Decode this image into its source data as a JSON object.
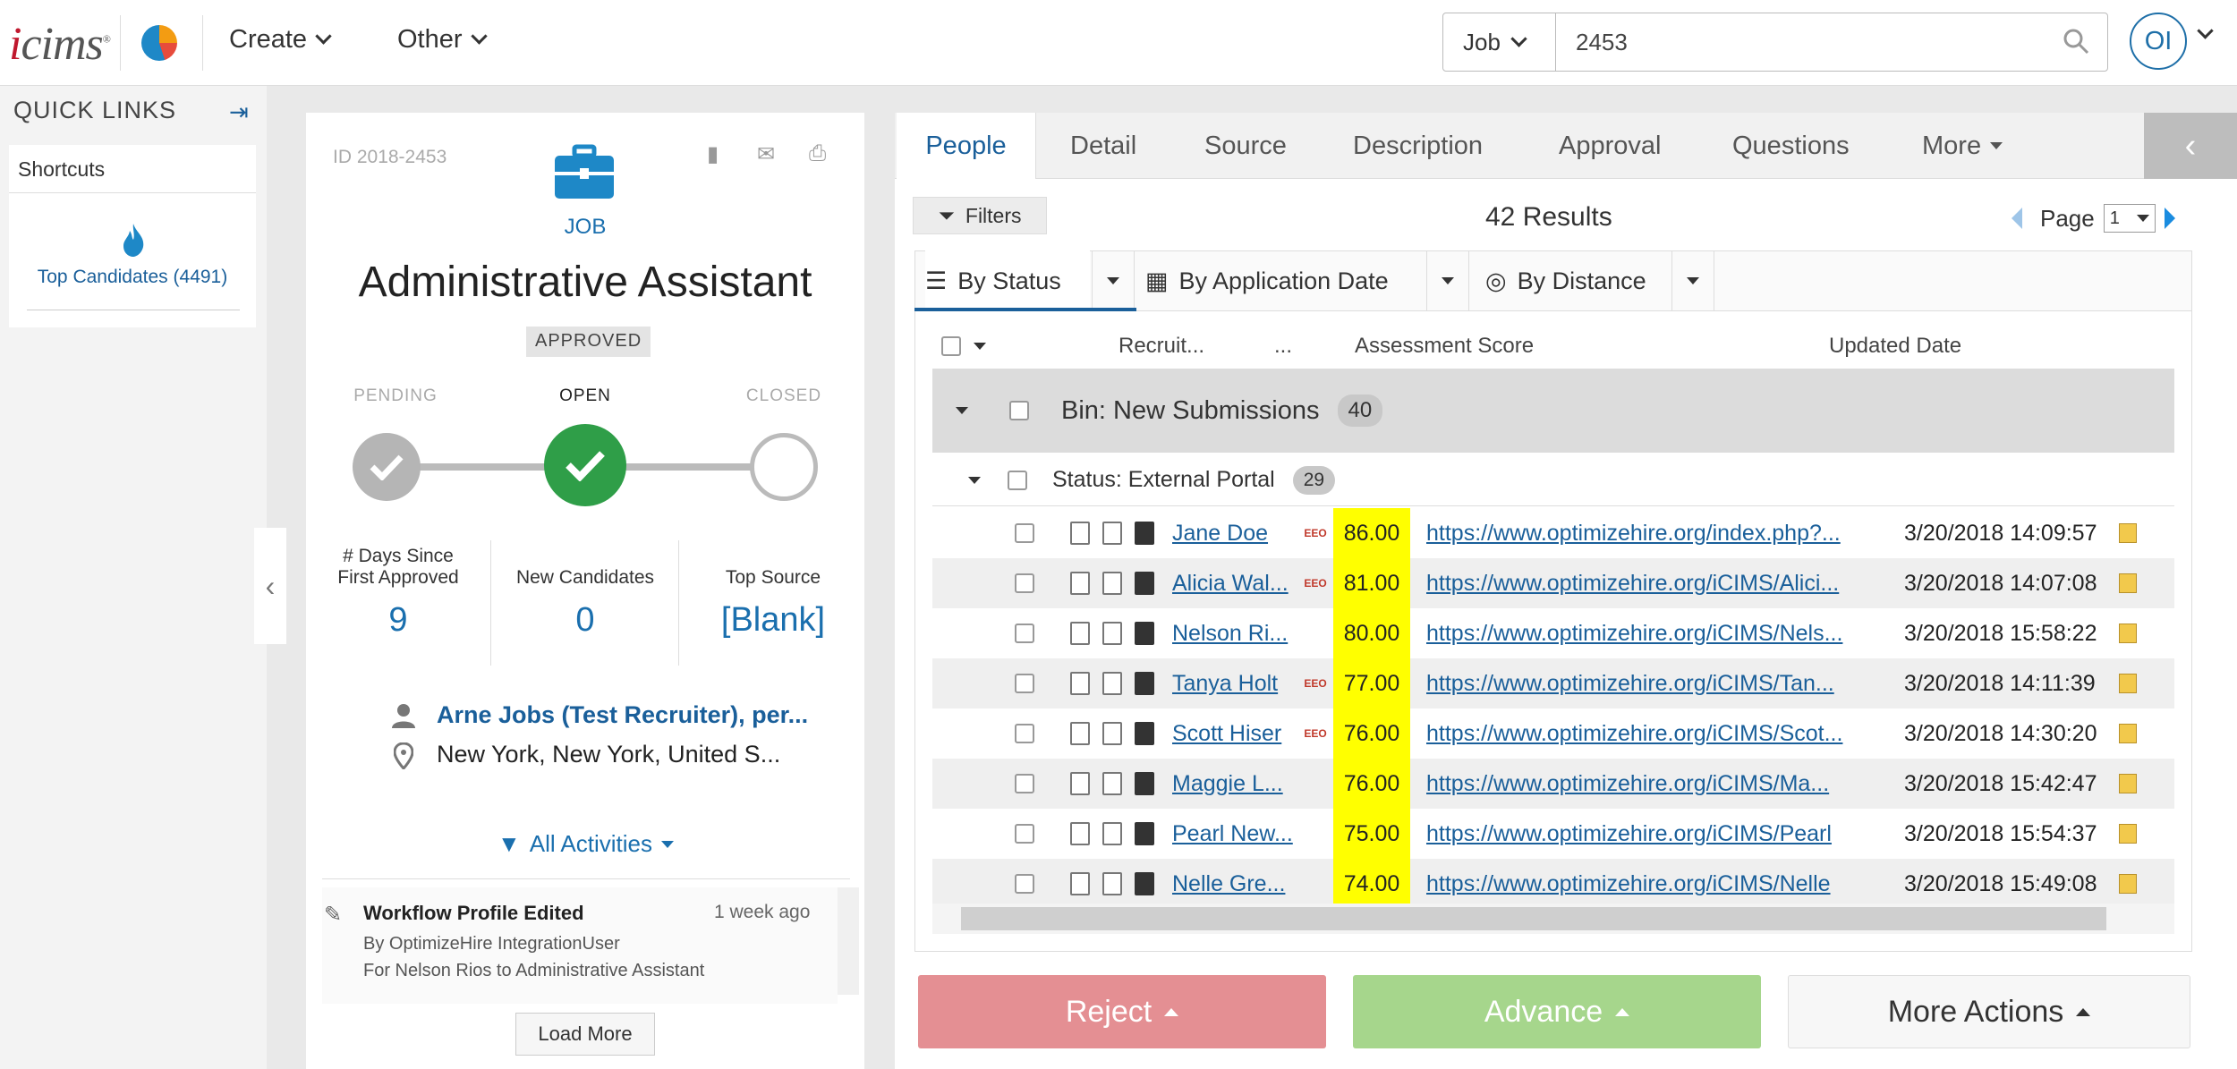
{
  "topbar": {
    "logo": "icims",
    "menu": [
      {
        "label": "Create"
      },
      {
        "label": "Other"
      }
    ],
    "search": {
      "type": "Job",
      "value": "2453"
    },
    "user_initials": "OI"
  },
  "quicklinks": {
    "title": "QUICK LINKS",
    "shortcuts": "Shortcuts",
    "top_candidates": "Top Candidates (4491)"
  },
  "job": {
    "id": "ID 2018-2453",
    "label": "JOB",
    "title": "Administrative Assistant",
    "status_badge": "APPROVED",
    "steps": [
      {
        "label": "PENDING"
      },
      {
        "label": "OPEN"
      },
      {
        "label": "CLOSED"
      }
    ],
    "stats": [
      {
        "label_line1": "# Days Since",
        "label_line2": "First Approved",
        "value": "9"
      },
      {
        "label_line1": "New Candidates",
        "label_line2": "",
        "value": "0"
      },
      {
        "label_line1": "Top Source",
        "label_line2": "",
        "value": "[Blank]"
      }
    ],
    "recruiter": "Arne Jobs (Test Recruiter), per...",
    "location": "New York, New York, United S...",
    "activities_label": "All Activities",
    "activity": {
      "title": "Workflow Profile Edited",
      "time": "1 week ago",
      "by": "By OptimizeHire IntegrationUser",
      "for": "For Nelson Rios to Administrative Assistant"
    },
    "load_more": "Load More"
  },
  "panel": {
    "tabs": [
      {
        "label": "People"
      },
      {
        "label": "Detail"
      },
      {
        "label": "Source"
      },
      {
        "label": "Description"
      },
      {
        "label": "Approval"
      },
      {
        "label": "Questions"
      },
      {
        "label": "More"
      }
    ],
    "filters_label": "Filters",
    "results": "42 Results",
    "page_label": "Page",
    "page_value": "1",
    "sort": [
      {
        "label": "By Status"
      },
      {
        "label": "By Application Date"
      },
      {
        "label": "By Distance"
      }
    ],
    "columns": {
      "recruiter": "Recruit...",
      "sort_col": "...",
      "assessment": "Assessment Score",
      "updated": "Updated Date"
    },
    "bin": {
      "label": "Bin: New Submissions",
      "count": "40"
    },
    "status": {
      "label": "Status: External Portal",
      "count": "29"
    },
    "rows": [
      {
        "name": "Jane Doe",
        "eeo": true,
        "score": "86.00",
        "url": "https://www.optimizehire.org/index.php?...",
        "date": "3/20/2018 14:09:57"
      },
      {
        "name": "Alicia Wal...",
        "eeo": true,
        "score": "81.00",
        "url": "https://www.optimizehire.org/iCIMS/Alici...",
        "date": "3/20/2018 14:07:08"
      },
      {
        "name": "Nelson Ri...",
        "eeo": false,
        "score": "80.00",
        "url": "https://www.optimizehire.org/iCIMS/Nels...",
        "date": "3/20/2018 15:58:22"
      },
      {
        "name": "Tanya Holt",
        "eeo": true,
        "score": "77.00",
        "url": "https://www.optimizehire.org/iCIMS/Tan...",
        "date": "3/20/2018 14:11:39"
      },
      {
        "name": "Scott Hiser",
        "eeo": true,
        "score": "76.00",
        "url": "https://www.optimizehire.org/iCIMS/Scot...",
        "date": "3/20/2018 14:30:20"
      },
      {
        "name": "Maggie L...",
        "eeo": false,
        "score": "76.00",
        "url": "https://www.optimizehire.org/iCIMS/Ma...",
        "date": "3/20/2018 15:42:47"
      },
      {
        "name": "Pearl New...",
        "eeo": false,
        "score": "75.00",
        "url": "https://www.optimizehire.org/iCIMS/Pearl",
        "date": "3/20/2018 15:54:37"
      },
      {
        "name": "Nelle Gre...",
        "eeo": false,
        "score": "74.00",
        "url": "https://www.optimizehire.org/iCIMS/Nelle",
        "date": "3/20/2018 15:49:08"
      }
    ],
    "eeo_text": "EEO",
    "actions": {
      "reject": "Reject",
      "advance": "Advance",
      "more": "More Actions"
    }
  },
  "colors": {
    "brand_red": "#c0182e",
    "link": "#1a5f9a",
    "open_green": "#2f9e48",
    "score_highlight": "#ffff00",
    "reject": "#e48f93",
    "advance": "#a6d68c"
  }
}
